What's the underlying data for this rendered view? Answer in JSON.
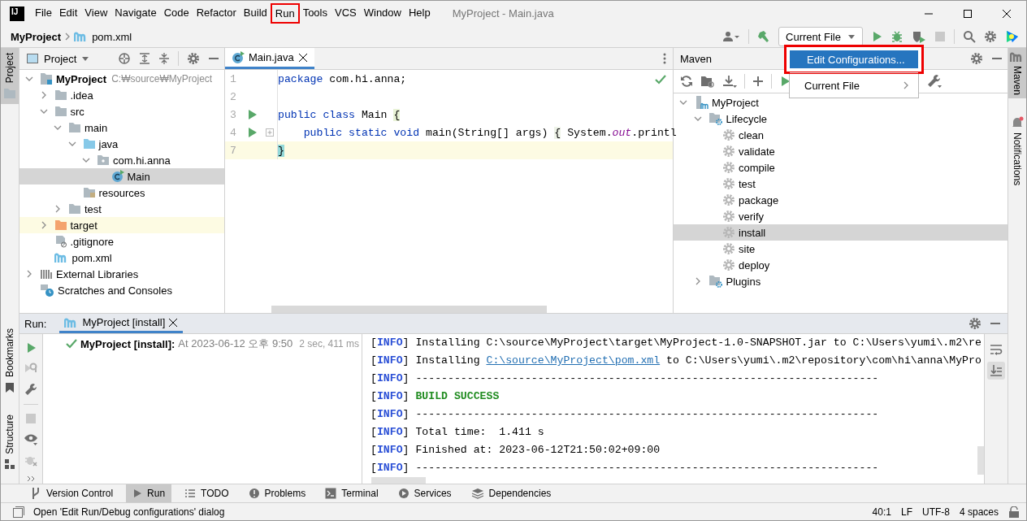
{
  "logo": {
    "text": "IJ"
  },
  "menu_bar": {
    "items": [
      {
        "label": "File",
        "highlighted": false
      },
      {
        "label": "Edit",
        "highlighted": false
      },
      {
        "label": "View",
        "highlighted": false
      },
      {
        "label": "Navigate",
        "highlighted": false
      },
      {
        "label": "Code",
        "highlighted": false
      },
      {
        "label": "Refactor",
        "highlighted": false
      },
      {
        "label": "Build",
        "highlighted": false
      },
      {
        "label": "Run",
        "highlighted": true
      },
      {
        "label": "Tools",
        "highlighted": false
      },
      {
        "label": "VCS",
        "highlighted": false
      },
      {
        "label": "Window",
        "highlighted": false
      },
      {
        "label": "Help",
        "highlighted": false
      }
    ],
    "title": "MyProject - Main.java"
  },
  "breadcrumb": [
    {
      "label": "MyProject",
      "kind": "project"
    },
    {
      "label": "pom.xml",
      "kind": "maven-file"
    }
  ],
  "run_config": {
    "label": "Current File"
  },
  "config_menu": {
    "items": [
      {
        "label": "Edit Configurations...",
        "selected": true,
        "highlighted": true
      },
      {
        "label": "Current File",
        "selected": false,
        "submenu": true
      }
    ]
  },
  "left_stripe": {
    "top": [
      {
        "label": "Project",
        "selected": true
      }
    ],
    "bottom": [
      {
        "label": "Bookmarks",
        "selected": false
      },
      {
        "label": "Structure",
        "selected": false
      }
    ]
  },
  "right_stripe": [
    {
      "label": "Maven",
      "selected": true
    },
    {
      "label": "Notifications",
      "selected": false
    }
  ],
  "project_panel": {
    "title": "Project",
    "tree": [
      {
        "label": "MyProject",
        "hint": "C:₩source₩MyProject",
        "kind": "module",
        "expanded": true,
        "selected": false,
        "highlighted": false,
        "children": [
          {
            "label": ".idea",
            "kind": "folder",
            "expanded": false,
            "selected": false,
            "highlighted": false
          },
          {
            "label": "src",
            "kind": "folder",
            "expanded": true,
            "selected": false,
            "highlighted": false,
            "children": [
              {
                "label": "main",
                "kind": "folder",
                "expanded": true,
                "selected": false,
                "highlighted": false,
                "children": [
                  {
                    "label": "java",
                    "kind": "source-folder",
                    "expanded": true,
                    "selected": false,
                    "highlighted": false,
                    "children": [
                      {
                        "label": "com.hi.anna",
                        "kind": "package",
                        "expanded": true,
                        "selected": false,
                        "highlighted": false,
                        "children": [
                          {
                            "label": "Main",
                            "kind": "class",
                            "selected": true,
                            "highlighted": false
                          }
                        ]
                      }
                    ]
                  },
                  {
                    "label": "resources",
                    "kind": "resources",
                    "selected": false,
                    "highlighted": false
                  }
                ]
              },
              {
                "label": "test",
                "kind": "folder",
                "expanded": false,
                "selected": false,
                "highlighted": false
              }
            ]
          },
          {
            "label": "target",
            "kind": "excluded-folder",
            "expanded": false,
            "selected": false,
            "highlighted": true
          },
          {
            "label": ".gitignore",
            "kind": "ignore-file",
            "selected": false,
            "highlighted": false
          },
          {
            "label": "pom.xml",
            "kind": "maven-file",
            "selected": false,
            "highlighted": false
          }
        ]
      },
      {
        "label": "External Libraries",
        "kind": "libraries",
        "expanded": false,
        "selected": false,
        "highlighted": false
      },
      {
        "label": "Scratches and Consoles",
        "kind": "scratches",
        "selected": false,
        "highlighted": false
      }
    ]
  },
  "editor": {
    "tabs": [
      {
        "label": "Main.java",
        "selected": true
      }
    ],
    "lines": [
      {
        "number": "1",
        "run": false,
        "fold": false,
        "current": false,
        "tokens": [
          {
            "text": "package",
            "kind": "keyword"
          },
          {
            "text": " com.hi.anna;",
            "kind": "plain"
          }
        ]
      },
      {
        "number": "2",
        "run": false,
        "fold": false,
        "current": false
      },
      {
        "number": "3",
        "run": true,
        "fold": false,
        "current": false,
        "tokens": [
          {
            "text": "public class",
            "kind": "keyword"
          },
          {
            "text": " Main ",
            "kind": "plain"
          },
          {
            "text": "{",
            "kind": "brace"
          }
        ]
      },
      {
        "number": "4",
        "run": true,
        "fold": true,
        "current": false,
        "tokens": [
          {
            "text": "    public static void",
            "kind": "keyword"
          },
          {
            "text": " main(String[] args) ",
            "kind": "plain"
          },
          {
            "text": "{",
            "kind": "folded"
          },
          {
            "text": " System.",
            "kind": "plain"
          },
          {
            "text": "out",
            "kind": "static"
          },
          {
            "text": ".printl",
            "kind": "plain"
          }
        ]
      },
      {
        "number": "7",
        "run": false,
        "fold": false,
        "current": true,
        "tokens": [
          {
            "text": "}",
            "kind": "brace-match"
          }
        ]
      }
    ]
  },
  "maven_panel": {
    "title": "Maven",
    "tree": [
      {
        "label": "MyProject",
        "kind": "maven-module",
        "expanded": true,
        "selected": false,
        "highlighted": false,
        "children": [
          {
            "label": "Lifecycle",
            "kind": "lifecycle",
            "expanded": true,
            "selected": false,
            "highlighted": false,
            "children": [
              {
                "label": "clean",
                "kind": "goal",
                "selected": false,
                "highlighted": false
              },
              {
                "label": "validate",
                "kind": "goal",
                "selected": false,
                "highlighted": false
              },
              {
                "label": "compile",
                "kind": "goal",
                "selected": false,
                "highlighted": false
              },
              {
                "label": "test",
                "kind": "goal",
                "selected": false,
                "highlighted": false
              },
              {
                "label": "package",
                "kind": "goal",
                "selected": false,
                "highlighted": false
              },
              {
                "label": "verify",
                "kind": "goal",
                "selected": false,
                "highlighted": false
              },
              {
                "label": "install",
                "kind": "goal",
                "selected": true,
                "highlighted": false
              },
              {
                "label": "site",
                "kind": "goal",
                "selected": false,
                "highlighted": false
              },
              {
                "label": "deploy",
                "kind": "goal",
                "selected": false,
                "highlighted": false
              }
            ]
          },
          {
            "label": "Plugins",
            "kind": "lifecycle",
            "expanded": false,
            "selected": false,
            "highlighted": false
          }
        ]
      }
    ]
  },
  "run_panel": {
    "label": "Run:",
    "tabs": [
      {
        "label": "MyProject [install]",
        "selected": true
      }
    ],
    "entry": {
      "title": "MyProject [install]:",
      "time": "At 2023-06-12 오후 9:50",
      "duration": "2 sec, 411 ms"
    },
    "console": [
      {
        "tag": "[**INFO**]",
        "parts": [
          {
            "text": " Installing C:\\source\\MyProject\\target\\MyProject-1.0-SNAPSHOT.jar to C:\\Users\\yumi\\.m2\\re",
            "kind": "plain"
          }
        ]
      },
      {
        "tag": "[**INFO**]",
        "parts": [
          {
            "text": " Installing ",
            "kind": "plain"
          },
          {
            "text": "C:\\source\\MyProject\\pom.xml",
            "kind": "link"
          },
          {
            "text": " to C:\\Users\\yumi\\.m2\\repository\\com\\hi\\anna\\MyPro",
            "kind": "plain"
          }
        ]
      },
      {
        "tag": "[**INFO**]",
        "parts": [
          {
            "text": " ------------------------------------------------------------------------",
            "kind": "plain"
          }
        ]
      },
      {
        "tag": "[**INFO**]",
        "parts": [
          {
            "text": " BUILD SUCCESS",
            "kind": "success"
          }
        ]
      },
      {
        "tag": "[**INFO**]",
        "parts": [
          {
            "text": " ------------------------------------------------------------------------",
            "kind": "plain"
          }
        ]
      },
      {
        "tag": "[**INFO**]",
        "parts": [
          {
            "text": " Total time:  1.411 s",
            "kind": "plain"
          }
        ]
      },
      {
        "tag": "[**INFO**]",
        "parts": [
          {
            "text": " Finished at: 2023-06-12T21:50:02+09:00",
            "kind": "plain"
          }
        ]
      },
      {
        "tag": "[**INFO**]",
        "parts": [
          {
            "text": " ------------------------------------------------------------------------",
            "kind": "plain"
          }
        ]
      }
    ]
  },
  "tool_tabs": [
    {
      "label": "Version Control",
      "selected": false
    },
    {
      "label": "Run",
      "selected": true
    },
    {
      "label": "TODO",
      "selected": false
    },
    {
      "label": "Problems",
      "selected": false
    },
    {
      "label": "Terminal",
      "selected": false
    },
    {
      "label": "Services",
      "selected": false
    },
    {
      "label": "Dependencies",
      "selected": false
    }
  ],
  "status_bar": {
    "message": "Open 'Edit Run/Debug configurations' dialog",
    "items": [
      "40:1",
      "LF",
      "UTF-8",
      "4 spaces"
    ]
  }
}
